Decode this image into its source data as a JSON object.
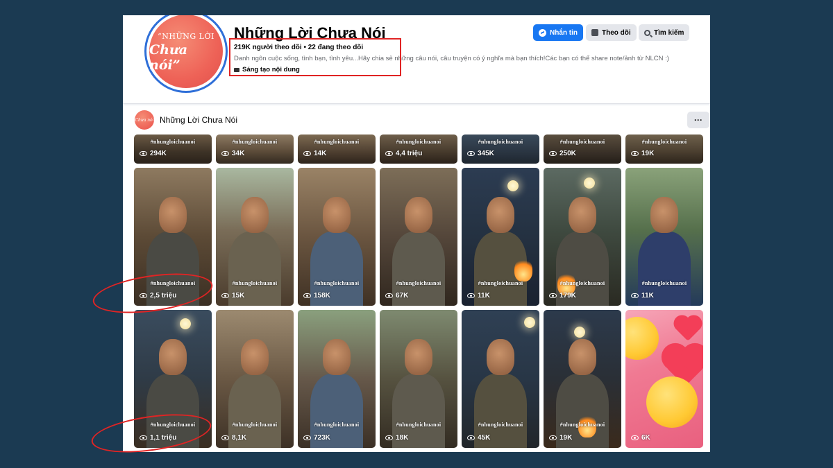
{
  "page": {
    "name": "Những Lời Chưa Nói",
    "avatar_text_line1": "“NHỮNG LỜI",
    "avatar_text_line2": "Chưa nói”",
    "stats": "219K người theo dõi • 22 đang theo dõi",
    "bio": "Danh ngôn cuộc sống, tình bạn, tình yêu...Hãy chia sẻ những câu nói, câu truyện có ý nghĩa mà bạn thích!Các bạn có thể share note/ảnh từ NLCN :)",
    "category": "Sáng tạo nội dung"
  },
  "actions": {
    "message": "Nhắn tin",
    "follow": "Theo dõi",
    "search": "Tìm kiếm"
  },
  "reels": {
    "page_name": "Những Lời Chưa Nói",
    "mini_avatar_text": "Chưa nói",
    "more": "···",
    "hashtag": "#nhungloichuanoi",
    "top_row_views": [
      "294K",
      "34K",
      "14K",
      "4,4 triệu",
      "345K",
      "250K",
      "19K"
    ],
    "row2_views": [
      "2,5 triệu",
      "15K",
      "158K",
      "67K",
      "11K",
      "179K",
      "11K"
    ],
    "row3_views": [
      "1,1 triệu",
      "8,1K",
      "723K",
      "18K",
      "45K",
      "19K",
      "6K"
    ]
  },
  "colors": {
    "background": "#1b3a52",
    "facebook_blue": "#1877f2",
    "annotation_red": "#e02424",
    "avatar_coral": "#ee6257"
  }
}
